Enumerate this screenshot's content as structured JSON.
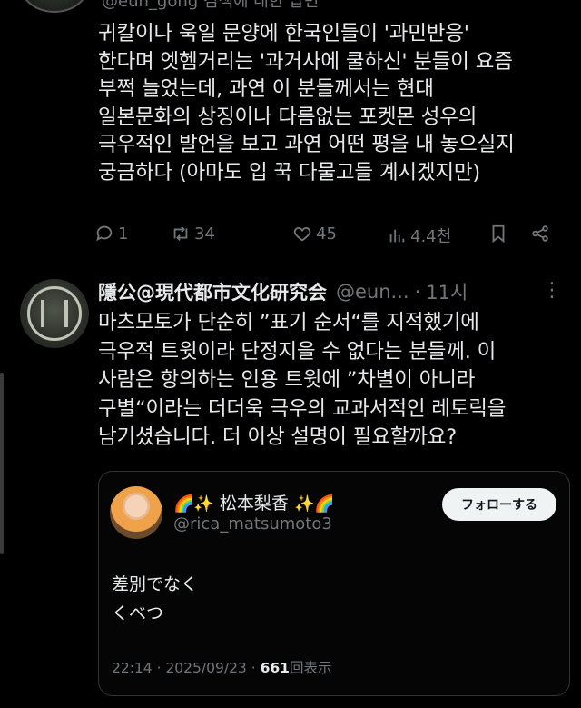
{
  "top_tweet": {
    "handle_partial": "@eun_gong 검색에 대한 답변",
    "lines": [
      "귀칼이나 욱일 문양에 한국인들이 '과민반응'",
      "한다며 엣헴거리는 '과거사에 쿨하신' 분들이 요즘",
      "부쩍 늘었는데, 과연 이 분들께서는 현대",
      "일본문화의 상징이나 다름없는 포켓몬 성우의",
      "극우적인 발언을 보고 과연 어떤 평을 내 놓으실지",
      "궁금하다 (아마도 입 꾹 다물고들 계시겠지만)"
    ],
    "actions": {
      "reply": "1",
      "retweet": "34",
      "like": "45",
      "views": "4.4천"
    }
  },
  "tweet2": {
    "name": "隱公@現代都市文化研究会",
    "handle": "@eun...",
    "dot": "·",
    "time": "11시",
    "more": "⋮",
    "lines": [
      "마츠모토가 단순히 ”표기 순서“를 지적했기에",
      "극우적 트윗이라 단정지을 수 없다는 분들께. 이",
      "사람은 항의하는 인용 트윗에 ”차별이 아니라",
      "구별“이라는 더더욱 극우의 교과서적인 레토릭을",
      "남기셨습니다. 더 이상 설명이 필요할까요?"
    ]
  },
  "quote": {
    "emoji_left": "🌈✨",
    "name": "松本梨香",
    "emoji_right": "✨🌈",
    "handle": "@rica_matsumoto3",
    "follow_label": "フォローする",
    "body": [
      "差別でなく",
      "くべつ"
    ],
    "meta_time": "22:14 · 2025/09/23 · ",
    "meta_views": "661",
    "meta_views_label": "回表示"
  },
  "icons": {
    "reply": "reply-icon",
    "retweet": "retweet-icon",
    "like": "heart-icon",
    "views": "views-icon",
    "bookmark": "bookmark-icon",
    "share": "share-icon"
  },
  "colors": {
    "background": "#000000",
    "text": "#e7e9ea",
    "muted": "#71767b",
    "border": "#2f3336",
    "follow_bg": "#eff3f4"
  }
}
